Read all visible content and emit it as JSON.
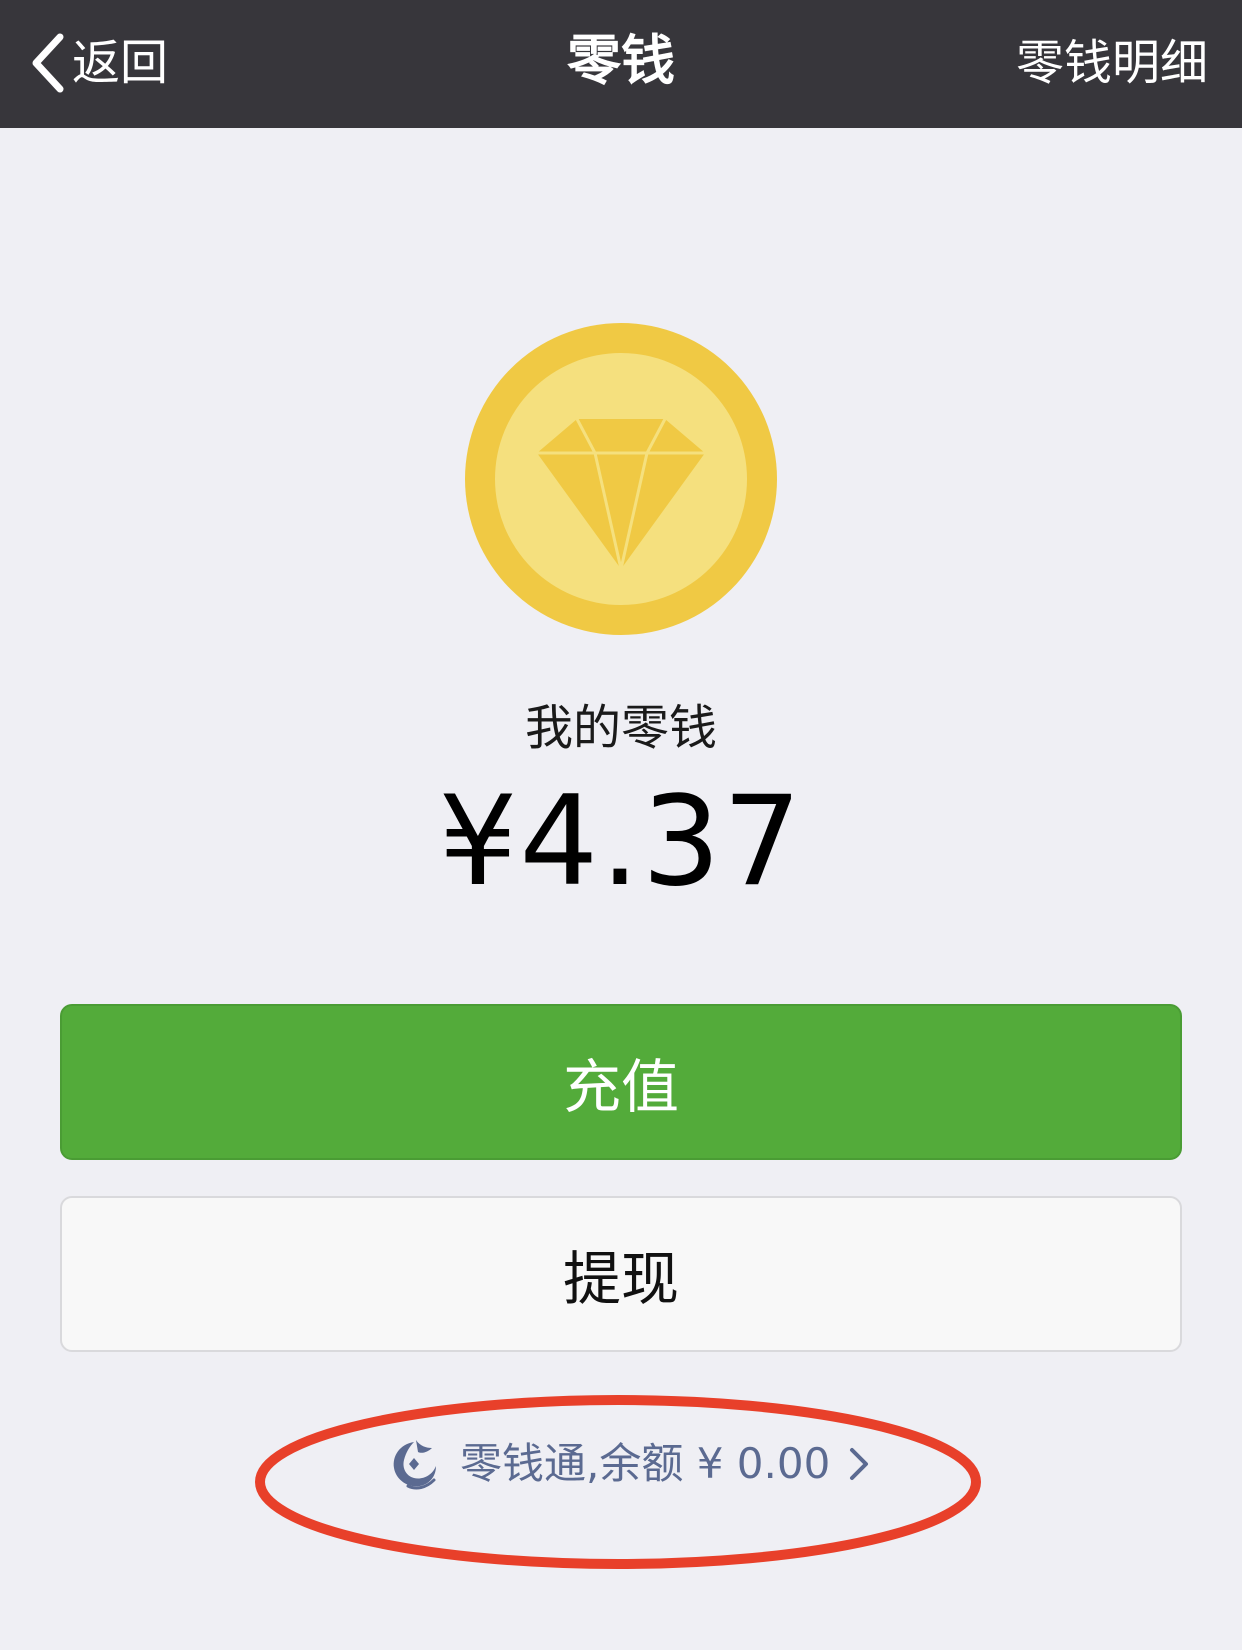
{
  "navbar": {
    "back_label": "返回",
    "title": "零钱",
    "right_label": "零钱明细"
  },
  "wallet": {
    "balance_label": "我的零钱",
    "balance_value": "¥4.37"
  },
  "actions": {
    "recharge_label": "充值",
    "withdraw_label": "提现"
  },
  "lingqiantong": {
    "text": "零钱通,余额 ¥ 0.00"
  },
  "icons": {
    "back": "chevron-left-icon",
    "coin": "diamond-coin-icon",
    "lingqiantong": "lingqiantong-icon",
    "link": "chevron-right-icon"
  },
  "colors": {
    "navbar_bg": "#37363b",
    "page_bg": "#efeff4",
    "primary_green": "#53ab3a",
    "coin_outer": "#f0c944",
    "coin_inner": "#f5e07e",
    "link_text": "#5b6a91",
    "annotation_red": "#e8402a"
  }
}
